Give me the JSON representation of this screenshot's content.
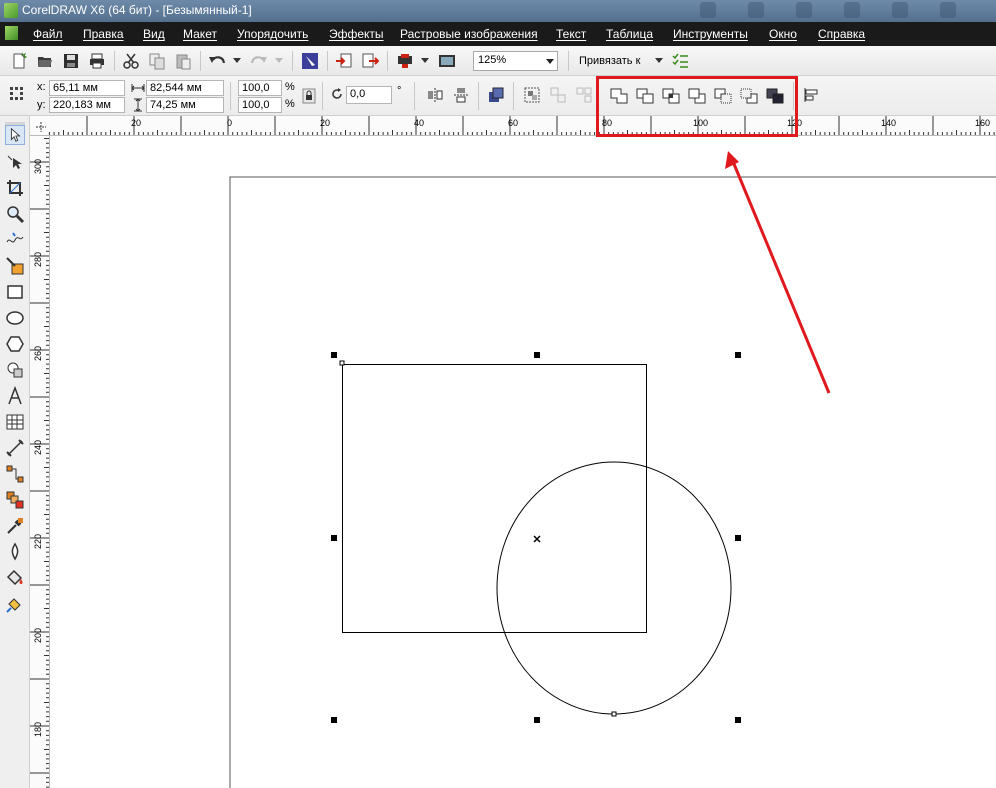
{
  "window": {
    "title": "CorelDRAW X6 (64 бит) - [Безымянный-1]"
  },
  "menu": [
    "Файл",
    "Правка",
    "Вид",
    "Макет",
    "Упорядочить",
    "Эффекты",
    "Растровые изображения",
    "Текст",
    "Таблица",
    "Инструменты",
    "Окно",
    "Справка"
  ],
  "toolbar": {
    "zoom": "125%",
    "snap_to": "Привязать к"
  },
  "property_bar": {
    "x_label": "x:",
    "x_value": "65,11 мм",
    "y_label": "y:",
    "y_value": "220,183 мм",
    "width_value": "82,544 мм",
    "height_value": "74,25 мм",
    "scale_x": "100,0",
    "scale_y": "100,0",
    "percent": "%",
    "rotation": "0,0",
    "degree": "°"
  },
  "rulers": {
    "horizontal": [
      "20",
      "0",
      "20",
      "40",
      "60",
      "80",
      "100",
      "120",
      "140",
      "160"
    ],
    "vertical": [
      "300",
      "280",
      "260",
      "240",
      "220",
      "200",
      "180"
    ]
  },
  "icons": {
    "shaping_buttons": [
      "weld-icon",
      "trim-icon",
      "intersect-icon",
      "simplify-icon",
      "front-minus-back-icon",
      "back-minus-front-icon",
      "create-boundary-icon"
    ],
    "tools": [
      "pick-tool-icon",
      "shape-tool-icon",
      "crop-tool-icon",
      "zoom-tool-icon",
      "freehand-tool-icon",
      "smart-fill-icon",
      "rectangle-tool-icon",
      "ellipse-tool-icon",
      "polygon-tool-icon",
      "basic-shapes-icon",
      "text-tool-icon",
      "table-tool-icon",
      "dimension-tool-icon",
      "connector-tool-icon",
      "blend-tool-icon",
      "eyedropper-tool-icon",
      "outline-tool-icon",
      "fill-tool-icon",
      "interactive-fill-icon"
    ]
  },
  "colors": {
    "highlight": "#e0191e",
    "menubar": "#1a1a1a"
  }
}
